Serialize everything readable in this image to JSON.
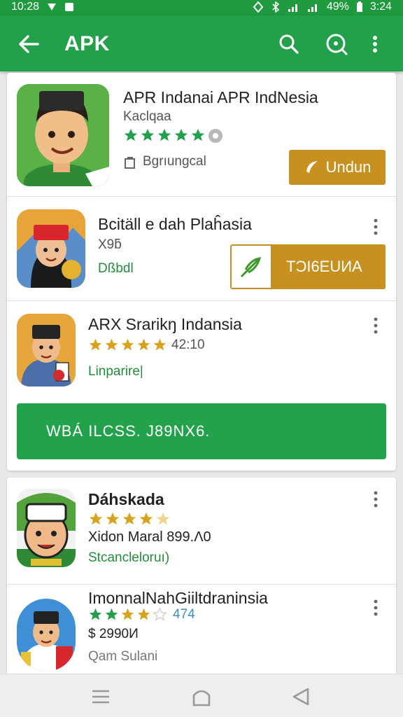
{
  "status": {
    "time_left": "10:28",
    "battery": "49%",
    "time_right": "3:24"
  },
  "appbar": {
    "title": "APK"
  },
  "apps": [
    {
      "name": "APR Indanai APR IndNesia",
      "developer": "Kaclqaa",
      "meta": "Bgrıungcal",
      "button": "Undun"
    },
    {
      "name": "Bcitäll e dah Plaĥasia",
      "sub": "X9ƃ",
      "meta": "Dßbdl",
      "button": "TƆI6EUИA"
    },
    {
      "name": "ARX Srarikŋ Indansia",
      "rating": "42:10",
      "meta": "Linparire|"
    },
    {
      "name": "Dáhskada",
      "sub": "Xidon Maral 899.Ʌ0",
      "meta": "Stcancleloruı)"
    },
    {
      "name": "ImonnalNahGiiltdraninsia",
      "rating": "474",
      "price": "$ 2990И",
      "meta": "Qam Sulani"
    }
  ],
  "banner": {
    "label": "WBÁ ILCSS. J89NX6."
  },
  "colors": {
    "primary": "#23a04a",
    "accent_gold": "#c8901f",
    "star_green": "#23a04a",
    "star_gold": "#d9a21e"
  }
}
